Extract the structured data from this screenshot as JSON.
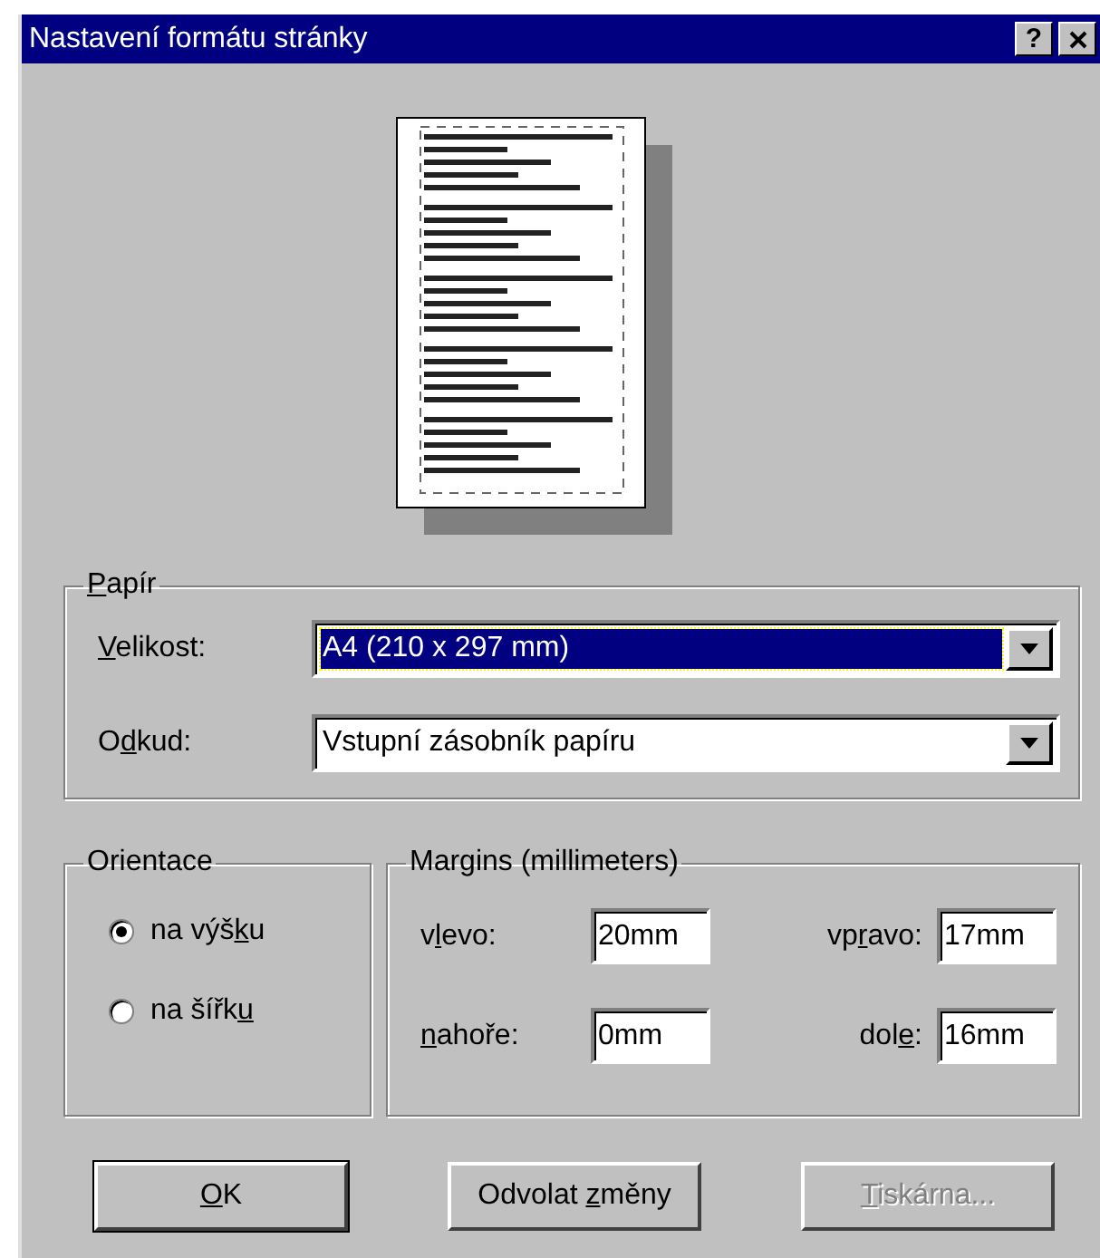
{
  "window": {
    "title": "Nastavení formátu stránky",
    "help_button": "?"
  },
  "paper": {
    "legend": {
      "key": "P",
      "after": "apír"
    },
    "fields": [
      {
        "label": {
          "key": "V",
          "after": "elikost:"
        },
        "value": "A4 (210 x 297 mm)",
        "focused": true
      },
      {
        "label": {
          "before": "O",
          "key": "d",
          "after": "kud:"
        },
        "value": "Vstupní zásobník papíru",
        "focused": false
      }
    ]
  },
  "orientation": {
    "legend": "Orientace",
    "options": [
      {
        "label": {
          "before": "na výš",
          "key": "k",
          "after": "u"
        },
        "selected": true
      },
      {
        "label": {
          "before": "na šířk",
          "key": "u"
        },
        "selected": false
      }
    ]
  },
  "margins": {
    "legend": "Margins (millimeters)",
    "fields": [
      {
        "label": {
          "before": "v",
          "key": "l",
          "after": "evo:"
        },
        "value": "20mm"
      },
      {
        "label": {
          "before": "vp",
          "key": "r",
          "after": "avo:"
        },
        "value": "17mm"
      },
      {
        "label": {
          "key": "n",
          "after": "ahoře:"
        },
        "value": "0mm"
      },
      {
        "label": {
          "before": "dol",
          "key": "e",
          "after": ":"
        },
        "value": "16mm"
      }
    ]
  },
  "buttons": [
    {
      "label": {
        "key": "O",
        "after": "K"
      },
      "default": true,
      "disabled": false
    },
    {
      "label": {
        "before": "Odvolat ",
        "key": "z",
        "after": "měny"
      },
      "default": false,
      "disabled": false
    },
    {
      "label": {
        "key": "T",
        "after": "iskárna..."
      },
      "default": false,
      "disabled": true
    }
  ]
}
